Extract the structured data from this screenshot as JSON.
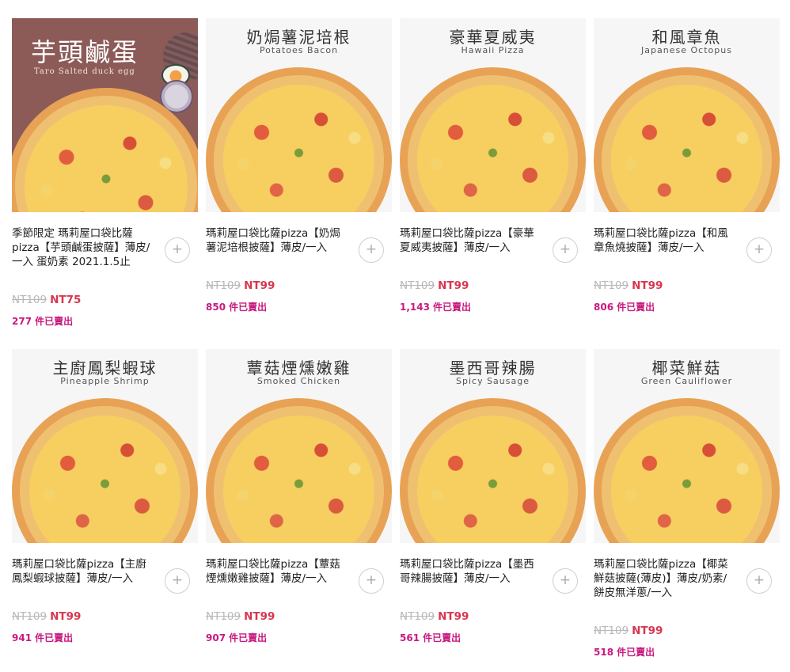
{
  "colors": {
    "price": "#d8364f",
    "sold": "#c8197f",
    "old_price": "#b8b8b8"
  },
  "products": [
    {
      "banner_title": "芋頭鹹蛋",
      "banner_sub": "Taro Salted duck egg",
      "name": "季節限定 瑪莉屋口袋比薩pizza【芋頭鹹蛋披薩】薄皮/一入 蛋奶素 2021.1.5止",
      "old_price": "NT109",
      "price": "NT75",
      "sold_count": "277",
      "sold_suffix": "件已賣出",
      "add_icon": "plus-icon",
      "add_label": "+"
    },
    {
      "banner_title": "奶焗薯泥培根",
      "banner_sub": "Potatoes Bacon",
      "name": "瑪莉屋口袋比薩pizza【奶焗薯泥培根披薩】薄皮/一入",
      "old_price": "NT109",
      "price": "NT99",
      "sold_count": "850",
      "sold_suffix": "件已賣出",
      "add_icon": "plus-icon",
      "add_label": "+"
    },
    {
      "banner_title": "豪華夏威夷",
      "banner_sub": "Hawaii Pizza",
      "name": "瑪莉屋口袋比薩pizza【豪華夏威夷披薩】薄皮/一入",
      "old_price": "NT109",
      "price": "NT99",
      "sold_count": "1,143",
      "sold_suffix": "件已賣出",
      "add_icon": "plus-icon",
      "add_label": "+"
    },
    {
      "banner_title": "和風章魚",
      "banner_sub": "Japanese Octopus",
      "name": "瑪莉屋口袋比薩pizza【和風章魚燒披薩】薄皮/一入",
      "old_price": "NT109",
      "price": "NT99",
      "sold_count": "806",
      "sold_suffix": "件已賣出",
      "add_icon": "plus-icon",
      "add_label": "+"
    },
    {
      "banner_title": "主廚鳳梨蝦球",
      "banner_sub": "Pineapple Shrimp",
      "name": "瑪莉屋口袋比薩pizza【主廚鳳梨蝦球披薩】薄皮/一入",
      "old_price": "NT109",
      "price": "NT99",
      "sold_count": "941",
      "sold_suffix": "件已賣出",
      "add_icon": "plus-icon",
      "add_label": "+"
    },
    {
      "banner_title": "蕈菇煙燻嫩雞",
      "banner_sub": "Smoked Chicken",
      "name": "瑪莉屋口袋比薩pizza【蕈菇煙燻嫩雞披薩】薄皮/一入",
      "old_price": "NT109",
      "price": "NT99",
      "sold_count": "907",
      "sold_suffix": "件已賣出",
      "add_icon": "plus-icon",
      "add_label": "+"
    },
    {
      "banner_title": "墨西哥辣腸",
      "banner_sub": "Spicy Sausage",
      "name": "瑪莉屋口袋比薩pizza【墨西哥辣腸披薩】薄皮/一入",
      "old_price": "NT109",
      "price": "NT99",
      "sold_count": "561",
      "sold_suffix": "件已賣出",
      "add_icon": "plus-icon",
      "add_label": "+"
    },
    {
      "banner_title": "椰菜鮮菇",
      "banner_sub": "Green Cauliflower",
      "name": "瑪莉屋口袋比薩pizza【椰菜鮮菇披薩(薄皮)】薄皮/奶素/餅皮無洋蔥/一入",
      "old_price": "NT109",
      "price": "NT99",
      "sold_count": "518",
      "sold_suffix": "件已賣出",
      "add_icon": "plus-icon",
      "add_label": "+"
    }
  ]
}
